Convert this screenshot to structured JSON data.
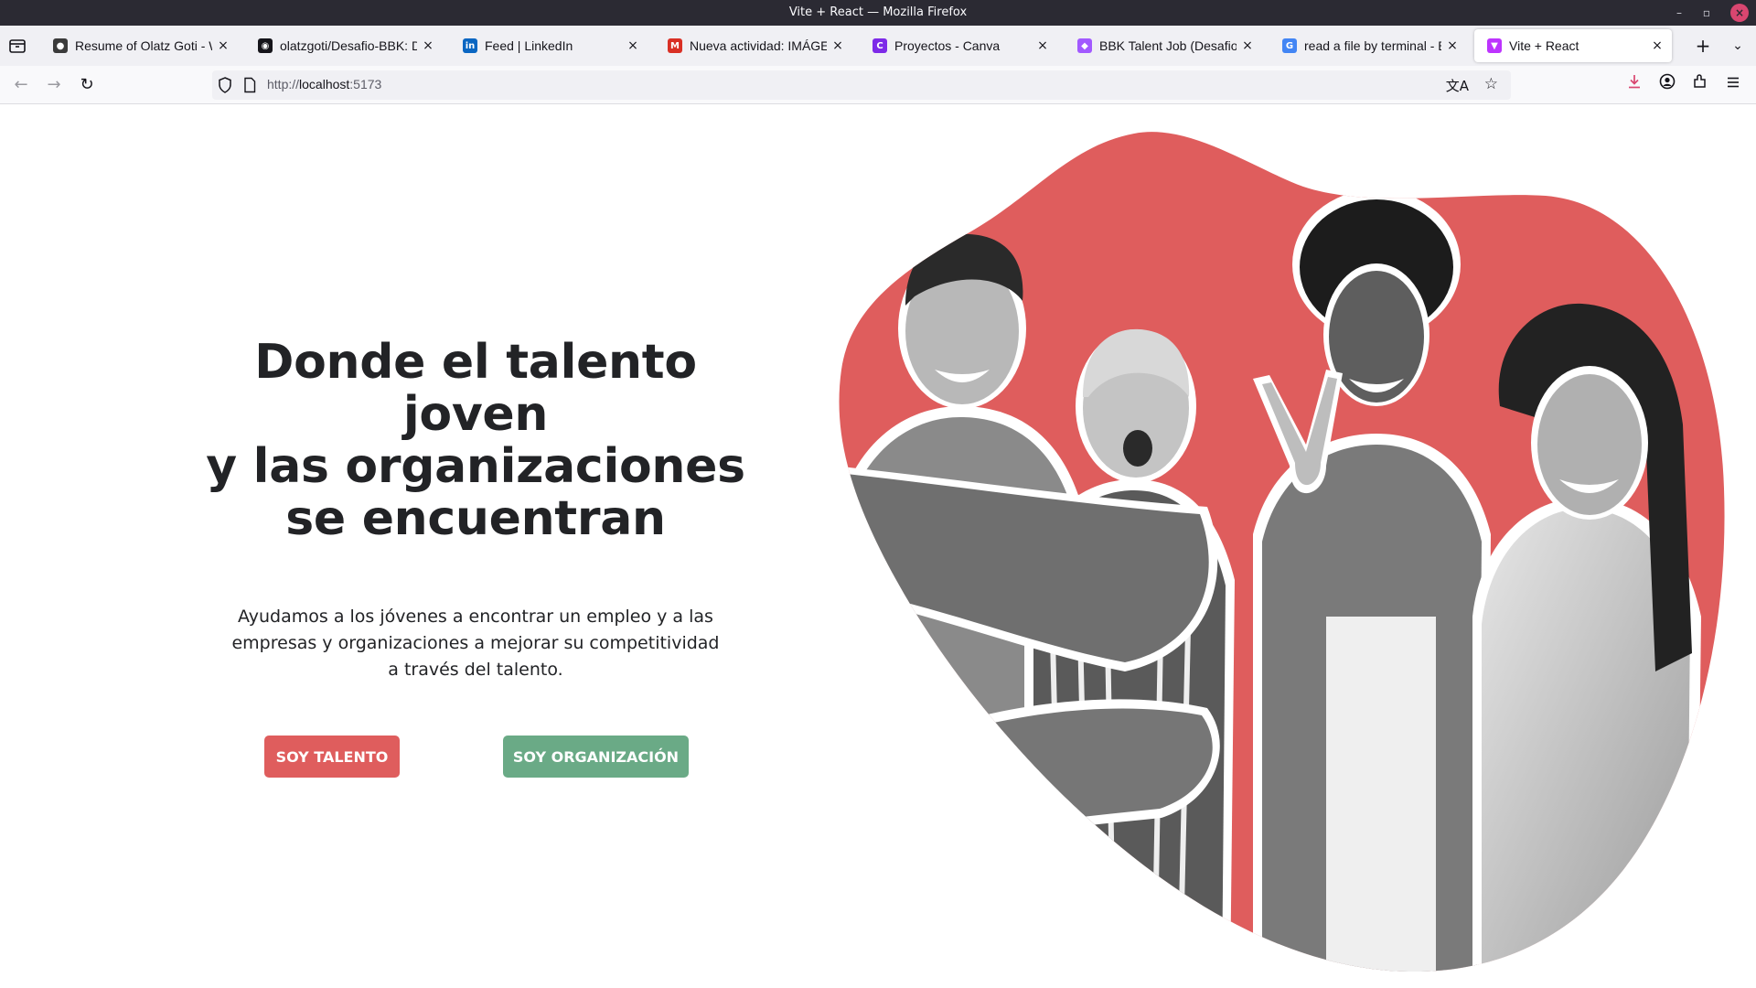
{
  "window": {
    "title": "Vite + React — Mozilla Firefox"
  },
  "tabs": [
    {
      "label": "Resume of Olatz Goti - Web",
      "icon": "resume-favicon",
      "color": "#3b3b3b"
    },
    {
      "label": "olatzgoti/Desafio-BBK: Desa",
      "icon": "github-favicon",
      "color": "#15141a"
    },
    {
      "label": "Feed | LinkedIn",
      "icon": "linkedin-favicon",
      "color": "#0a66c2"
    },
    {
      "label": "Nueva actividad: IMÁGENES",
      "icon": "gmail-favicon",
      "color": "#d93025"
    },
    {
      "label": "Proyectos - Canva",
      "icon": "canva-favicon",
      "color": "#7d2ae8"
    },
    {
      "label": "BBK Talent Job (Desafio Trip",
      "icon": "figma-favicon",
      "color": "#a259ff"
    },
    {
      "label": "read a file by terminal - Busc",
      "icon": "google-favicon",
      "color": "#4285f4"
    },
    {
      "label": "Vite + React",
      "icon": "vite-favicon",
      "color": "#bd34fe"
    }
  ],
  "navbar": {
    "url_scheme": "http://",
    "url_host": "localhost",
    "url_port": ":5173"
  },
  "hero": {
    "title_line1": "Donde el talento joven",
    "title_line2": "y las organizaciones",
    "title_line3": "se encuentran",
    "text": "Ayudamos a los jóvenes a encontrar un empleo y a las empresas y organizaciones a mejorar su competitividad a través del talento.",
    "button_talento": "SOY TALENTO",
    "button_organizacion": "SOY ORGANIZACIÓN"
  },
  "colors": {
    "accent_red": "#df5d5d",
    "accent_green": "#6aaa86",
    "text_dark": "#222326"
  }
}
